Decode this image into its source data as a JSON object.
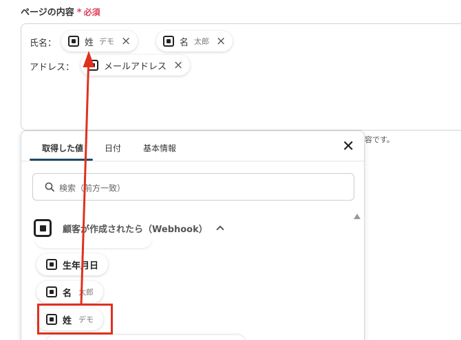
{
  "field": {
    "label": "ページの内容",
    "required_star": "*",
    "required_text": "必須"
  },
  "editor": {
    "rows": [
      {
        "label": "氏名："
      },
      {
        "label": "アドレス："
      }
    ],
    "chips": [
      {
        "main": "姓",
        "sub": "デモ",
        "remove": "×"
      },
      {
        "main": "名",
        "sub": "太郎",
        "remove": "×"
      },
      {
        "main": "メールアドレス",
        "remove": "×"
      }
    ]
  },
  "note": "容です。",
  "popup": {
    "tabs": [
      "取得した値",
      "日付",
      "基本情報"
    ],
    "active_tab": 0,
    "close": "✕",
    "search": {
      "placeholder": "検索（前方一致）"
    },
    "group": {
      "title": "顧客が作成されたら（Webhook）"
    },
    "items": [
      {
        "main": "生年月日",
        "sub": ""
      },
      {
        "main": "名",
        "sub": "太郎"
      },
      {
        "main": "姓",
        "sub": "デモ"
      }
    ]
  },
  "colors": {
    "annotation": "#e0301e",
    "accent_tab": "#1d4a6b",
    "required": "#e0405a"
  },
  "icons": {
    "value_icon": "square-app-icon",
    "remove_icon": "close-icon",
    "search_icon": "search-icon",
    "collapse_icon": "chevron-up-icon"
  }
}
